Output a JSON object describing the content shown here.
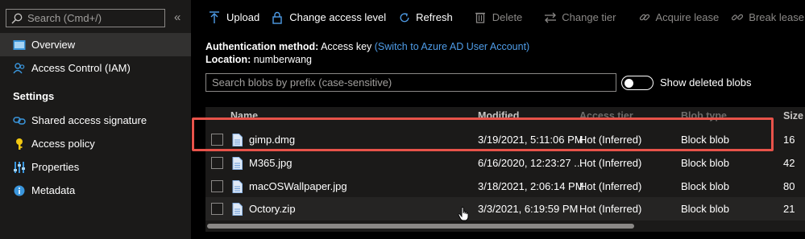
{
  "sidebar": {
    "search_placeholder": "Search (Cmd+/)",
    "collapse_label": "«",
    "items": [
      {
        "label": "Overview",
        "icon": "overview-icon"
      },
      {
        "label": "Access Control (IAM)",
        "icon": "people-icon"
      }
    ],
    "settings_title": "Settings",
    "settings_items": [
      {
        "label": "Shared access signature",
        "icon": "link-icon"
      },
      {
        "label": "Access policy",
        "icon": "key-icon"
      },
      {
        "label": "Properties",
        "icon": "sliders-icon"
      },
      {
        "label": "Metadata",
        "icon": "info-icon"
      }
    ]
  },
  "toolbar": {
    "upload": "Upload",
    "change_access": "Change access level",
    "refresh": "Refresh",
    "delete": "Delete",
    "change_tier": "Change tier",
    "acquire_lease": "Acquire lease",
    "break_lease": "Break lease",
    "more": "···"
  },
  "auth": {
    "method_label": "Authentication method:",
    "method_value": "Access key",
    "switch_link": "(Switch to Azure AD User Account)",
    "location_label": "Location:",
    "location_value": "numberwang"
  },
  "blob_search": {
    "placeholder": "Search blobs by prefix (case-sensitive)"
  },
  "deleted_toggle": {
    "label": "Show deleted blobs",
    "on": false
  },
  "grid": {
    "headers": [
      "Name",
      "Modified",
      "Access tier",
      "Blob type",
      "Size"
    ],
    "rows": [
      {
        "name": "gimp.dmg",
        "modified": "3/19/2021, 5:11:06 PM",
        "tier": "Hot (Inferred)",
        "type": "Block blob",
        "size": "16"
      },
      {
        "name": "M365.jpg",
        "modified": "6/16/2020, 12:23:27 ...",
        "tier": "Hot (Inferred)",
        "type": "Block blob",
        "size": "42"
      },
      {
        "name": "macOSWallpaper.jpg",
        "modified": "3/18/2021, 2:06:14 PM",
        "tier": "Hot (Inferred)",
        "type": "Block blob",
        "size": "80"
      },
      {
        "name": "Octory.zip",
        "modified": "3/3/2021, 6:19:59 PM",
        "tier": "Hot (Inferred)",
        "type": "Block blob",
        "size": "21"
      }
    ]
  },
  "colors": {
    "highlight": "#e8534a",
    "link": "#4f9de8",
    "accent": "#3a96dd"
  }
}
